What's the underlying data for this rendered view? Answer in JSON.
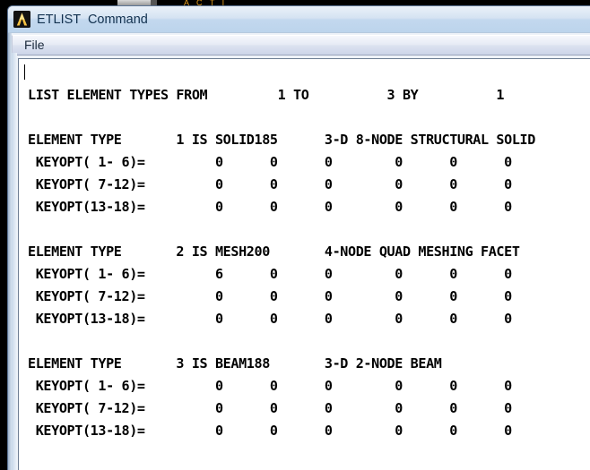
{
  "desktop": {
    "background_color": "#000000",
    "partial_text_behind": "A C T I"
  },
  "window": {
    "title": "ETLIST  Command",
    "icon": "ansys-logo-icon",
    "accent_color": "#c3d8ee",
    "menu": {
      "items": [
        {
          "label": "File"
        }
      ]
    }
  },
  "console": {
    "header": {
      "text": "LIST ELEMENT TYPES FROM",
      "from": "1",
      "from_label": "TO",
      "to": "3",
      "by_label": "BY",
      "by": "1"
    },
    "keyopt_row_labels": [
      "KEYOPT( 1- 6)=",
      "KEYOPT( 7-12)=",
      "KEYOPT(13-18)="
    ],
    "element_type_label": "ELEMENT TYPE",
    "is_label": "IS",
    "blocks": [
      {
        "number": "1",
        "name": "SOLID185",
        "description": "3-D 8-NODE STRUCTURAL SOLID",
        "keyopts": [
          [
            "0",
            "0",
            "0",
            "0",
            "0",
            "0"
          ],
          [
            "0",
            "0",
            "0",
            "0",
            "0",
            "0"
          ],
          [
            "0",
            "0",
            "0",
            "0",
            "0",
            "0"
          ]
        ]
      },
      {
        "number": "2",
        "name": "MESH200",
        "description": "4-NODE QUAD MESHING FACET",
        "keyopts": [
          [
            "6",
            "0",
            "0",
            "0",
            "0",
            "0"
          ],
          [
            "0",
            "0",
            "0",
            "0",
            "0",
            "0"
          ],
          [
            "0",
            "0",
            "0",
            "0",
            "0",
            "0"
          ]
        ]
      },
      {
        "number": "3",
        "name": "BEAM188",
        "description": "3-D 2-NODE BEAM",
        "keyopts": [
          [
            "0",
            "0",
            "0",
            "0",
            "0",
            "0"
          ],
          [
            "0",
            "0",
            "0",
            "0",
            "0",
            "0"
          ],
          [
            "0",
            "0",
            "0",
            "0",
            "0",
            "0"
          ]
        ]
      }
    ]
  }
}
